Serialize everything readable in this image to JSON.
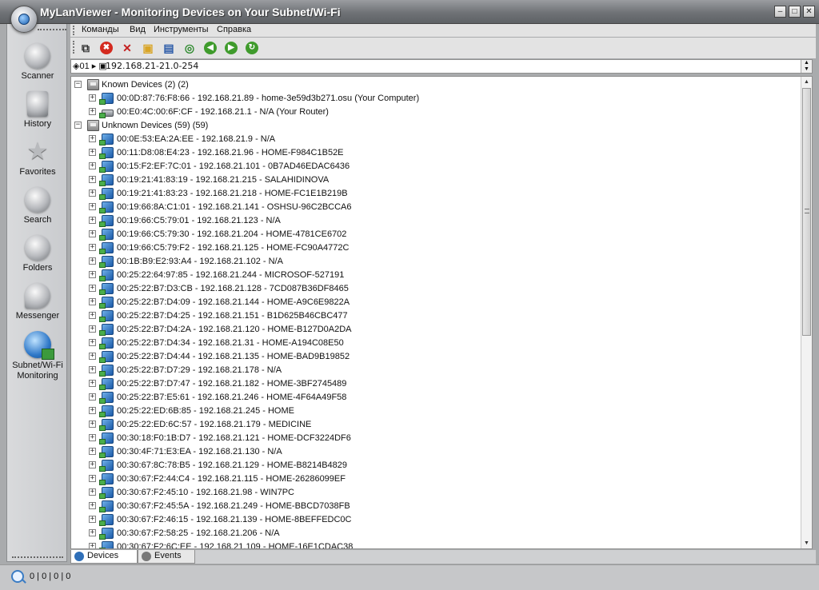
{
  "window": {
    "title": "MyLanViewer - Monitoring Devices on Your Subnet/Wi-Fi",
    "min_label": "–",
    "max_label": "□",
    "close_label": "✕"
  },
  "menu": {
    "items": [
      "Команды",
      "Вид",
      "Инструменты",
      "Справка"
    ]
  },
  "toolbar": {
    "buttons": [
      {
        "name": "export",
        "glyph": "⧉",
        "color": "#333333"
      },
      {
        "name": "stop",
        "glyph": "✖",
        "color": "#d42a1f"
      },
      {
        "name": "delete",
        "glyph": "✕",
        "color": "#c42020"
      },
      {
        "name": "open",
        "glyph": "▣",
        "color": "#d9a526"
      },
      {
        "name": "save",
        "glyph": "▤",
        "color": "#2a5aa8"
      },
      {
        "name": "find",
        "glyph": "◎",
        "color": "#2e8a2e"
      },
      {
        "name": "back",
        "glyph": "◀",
        "color": "#3f9b2c"
      },
      {
        "name": "forward",
        "glyph": "▶",
        "color": "#3f9b2c"
      },
      {
        "name": "refresh",
        "glyph": "↻",
        "color": "#3f9b2c"
      }
    ]
  },
  "address": {
    "prefix": "◈01 ▸ ▣",
    "value": "192.168.21-21.0-254",
    "scroll_up": "▲",
    "scroll_down": "▼"
  },
  "sidebar": {
    "items": [
      {
        "label": "Scanner",
        "icon": "scanner-icon"
      },
      {
        "label": "History",
        "icon": "history-icon"
      },
      {
        "label": "Favorites",
        "icon": "star-icon"
      },
      {
        "label": "Search",
        "icon": "search-icon"
      },
      {
        "label": "Folders",
        "icon": "folders-icon"
      },
      {
        "label": "Messenger",
        "icon": "messenger-icon"
      },
      {
        "label": "Subnet/Wi-Fi Monitoring",
        "icon": "subnet-monitoring-icon"
      }
    ]
  },
  "tree": {
    "groups": [
      {
        "label": "Known Devices (2) (2)",
        "expander": "−",
        "devices": [
          {
            "label": "00:0D:87:76:F8:66 - 192.168.21.89 - home-3e59d3b271.osu (Your Computer)",
            "icon": "pc"
          },
          {
            "label": "00:E0:4C:00:6F:CF - 192.168.21.1 - N/A (Your Router)",
            "icon": "router"
          }
        ]
      },
      {
        "label": "Unknown Devices (59) (59)",
        "expander": "−",
        "devices": [
          {
            "label": "00:0E:53:EA:2A:EE - 192.168.21.9 - N/A",
            "icon": "pc"
          },
          {
            "label": "00:11:D8:08:E4:23 - 192.168.21.96 - HOME-F984C1B52E",
            "icon": "pc"
          },
          {
            "label": "00:15:F2:EF:7C:01 - 192.168.21.101 - 0B7AD46EDAC6436",
            "icon": "pc"
          },
          {
            "label": "00:19:21:41:83:19 - 192.168.21.215 - SALAHIDINOVA",
            "icon": "pc"
          },
          {
            "label": "00:19:21:41:83:23 - 192.168.21.218 - HOME-FC1E1B219B",
            "icon": "pc"
          },
          {
            "label": "00:19:66:8A:C1:01 - 192.168.21.141 - OSHSU-96C2BCCA6",
            "icon": "pc"
          },
          {
            "label": "00:19:66:C5:79:01 - 192.168.21.123 - N/A",
            "icon": "pc"
          },
          {
            "label": "00:19:66:C5:79:30 - 192.168.21.204 - HOME-4781CE6702",
            "icon": "pc"
          },
          {
            "label": "00:19:66:C5:79:F2 - 192.168.21.125 - HOME-FC90A4772C",
            "icon": "pc"
          },
          {
            "label": "00:1B:B9:E2:93:A4 - 192.168.21.102 - N/A",
            "icon": "pc"
          },
          {
            "label": "00:25:22:64:97:85 - 192.168.21.244 - MICROSOF-527191",
            "icon": "pc"
          },
          {
            "label": "00:25:22:B7:D3:CB - 192.168.21.128 - 7CD087B36DF8465",
            "icon": "pc"
          },
          {
            "label": "00:25:22:B7:D4:09 - 192.168.21.144 - HOME-A9C6E9822A",
            "icon": "pc"
          },
          {
            "label": "00:25:22:B7:D4:25 - 192.168.21.151 - B1D625B46CBC477",
            "icon": "pc"
          },
          {
            "label": "00:25:22:B7:D4:2A - 192.168.21.120 - HOME-B127D0A2DA",
            "icon": "pc"
          },
          {
            "label": "00:25:22:B7:D4:34 - 192.168.21.31 - HOME-A194C08E50",
            "icon": "pc"
          },
          {
            "label": "00:25:22:B7:D4:44 - 192.168.21.135 - HOME-BAD9B19852",
            "icon": "pc"
          },
          {
            "label": "00:25:22:B7:D7:29 - 192.168.21.178 - N/A",
            "icon": "pc"
          },
          {
            "label": "00:25:22:B7:D7:47 - 192.168.21.182 - HOME-3BF2745489",
            "icon": "pc"
          },
          {
            "label": "00:25:22:B7:E5:61 - 192.168.21.246 - HOME-4F64A49F58",
            "icon": "pc"
          },
          {
            "label": "00:25:22:ED:6B:85 - 192.168.21.245 - HOME",
            "icon": "pc"
          },
          {
            "label": "00:25:22:ED:6C:57 - 192.168.21.179 - MEDICINE",
            "icon": "pc"
          },
          {
            "label": "00:30:18:F0:1B:D7 - 192.168.21.121 - HOME-DCF3224DF6",
            "icon": "pc"
          },
          {
            "label": "00:30:4F:71:E3:EA - 192.168.21.130 - N/A",
            "icon": "pc"
          },
          {
            "label": "00:30:67:8C:78:B5 - 192.168.21.129 - HOME-B8214B4829",
            "icon": "pc"
          },
          {
            "label": "00:30:67:F2:44:C4 - 192.168.21.115 - HOME-26286099EF",
            "icon": "pc"
          },
          {
            "label": "00:30:67:F2:45:10 - 192.168.21.98 - WIN7PC",
            "icon": "pc"
          },
          {
            "label": "00:30:67:F2:45:5A - 192.168.21.249 - HOME-BBCD7038FB",
            "icon": "pc"
          },
          {
            "label": "00:30:67:F2:46:15 - 192.168.21.139 - HOME-8BEFFEDC0C",
            "icon": "pc"
          },
          {
            "label": "00:30:67:F2:58:25 - 192.168.21.206 - N/A",
            "icon": "pc"
          },
          {
            "label": "00:30:67:F2:6C:EE - 192.168.21.109 - HOME-16E1CDAC38",
            "icon": "pc"
          }
        ]
      }
    ],
    "device_expander": "+"
  },
  "scrollbar": {
    "up": "▲",
    "down": "▼"
  },
  "tabs": [
    {
      "label": "Devices",
      "active": true
    },
    {
      "label": "Events",
      "active": false
    }
  ],
  "status": {
    "text": "0 | 0 | 0 | 0"
  }
}
